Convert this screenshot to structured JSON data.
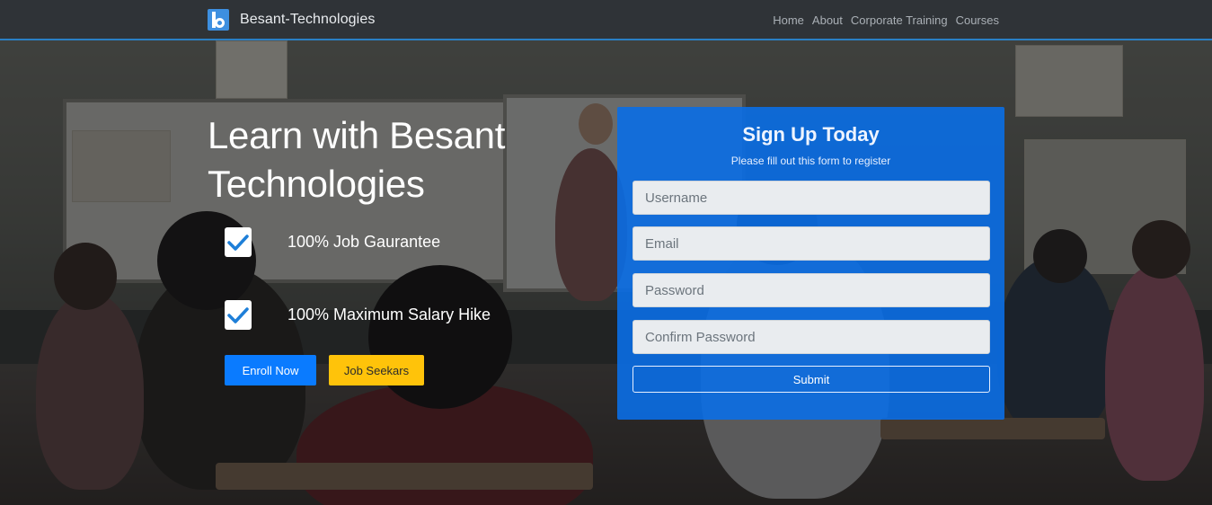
{
  "brand": {
    "name": "Besant-Technologies",
    "logo_icon": "b-logo-icon"
  },
  "nav": {
    "items": [
      {
        "label": "Home"
      },
      {
        "label": "About"
      },
      {
        "label": "Corporate Training"
      },
      {
        "label": "Courses"
      }
    ]
  },
  "hero": {
    "headline_light": "Learn with ",
    "headline_bold": "Besant Technologies",
    "features": [
      {
        "label": "100% Job Gaurantee",
        "icon": "checkmark-icon"
      },
      {
        "label": "100% Maximum Salary Hike",
        "icon": "checkmark-icon"
      }
    ],
    "buttons": {
      "enroll": "Enroll Now",
      "job_seekers": "Job Seekars"
    }
  },
  "signup": {
    "title": "Sign Up Today",
    "subtitle": "Please fill out this form to register",
    "fields": [
      {
        "placeholder": "Username",
        "value": ""
      },
      {
        "placeholder": "Email",
        "value": ""
      },
      {
        "placeholder": "Password",
        "value": ""
      },
      {
        "placeholder": "Confirm Password",
        "value": ""
      }
    ],
    "submit_label": "Submit"
  },
  "colors": {
    "navbar_bg": "#2f3337",
    "navbar_border": "#2a7fc4",
    "primary": "#0a7bff",
    "warning": "#ffc30a",
    "form_bg": "#0a6ee6"
  }
}
